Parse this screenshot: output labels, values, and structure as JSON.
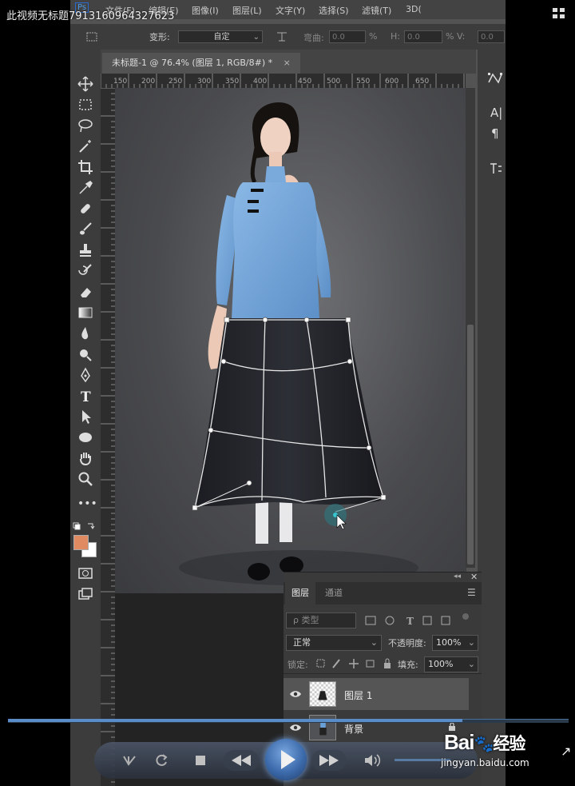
{
  "video": {
    "title": "此视频无标题7913160964327623",
    "progress": 0.81
  },
  "menubar": {
    "items": [
      "Ps",
      "文件(F)",
      "编辑(E)",
      "图像(I)",
      "图层(L)",
      "文字(Y)",
      "选择(S)",
      "滤镜(T)",
      "3D("
    ]
  },
  "options": {
    "transform_label": "变形:",
    "preset_value": "自定",
    "bend_label": "弯曲:",
    "bend_value": "0.0",
    "percent": "%",
    "h_label": "H:",
    "h_value": "0.0",
    "v_label": "% V:",
    "v_value": "0.0"
  },
  "document": {
    "tab_title": "未标题-1 @ 76.4% (图层 1, RGB/8#) *",
    "close": "×",
    "ruler_ticks": [
      "150",
      "200",
      "250",
      "300",
      "350",
      "400",
      "450",
      "500",
      "550",
      "600",
      "650"
    ]
  },
  "layers_panel": {
    "tabs": [
      "图层",
      "通道"
    ],
    "filter_label": "ρ 类型",
    "blend_mode": "正常",
    "opacity_label": "不透明度:",
    "opacity_value": "100%",
    "lock_label": "锁定:",
    "fill_label": "填充:",
    "fill_value": "100%",
    "layers": [
      {
        "name": "图层 1",
        "selected": true
      },
      {
        "name": "背景",
        "locked": true
      }
    ]
  },
  "right_panel": {
    "char_label": "A|",
    "para_label": "¶"
  },
  "watermark": {
    "logo": "Bai",
    "logo_cn": "经验",
    "url": "jingyan.baidu.com"
  },
  "colors": {
    "foreground": "#e08a62",
    "background": "#ffffff",
    "accent": "#5a8cc8"
  }
}
